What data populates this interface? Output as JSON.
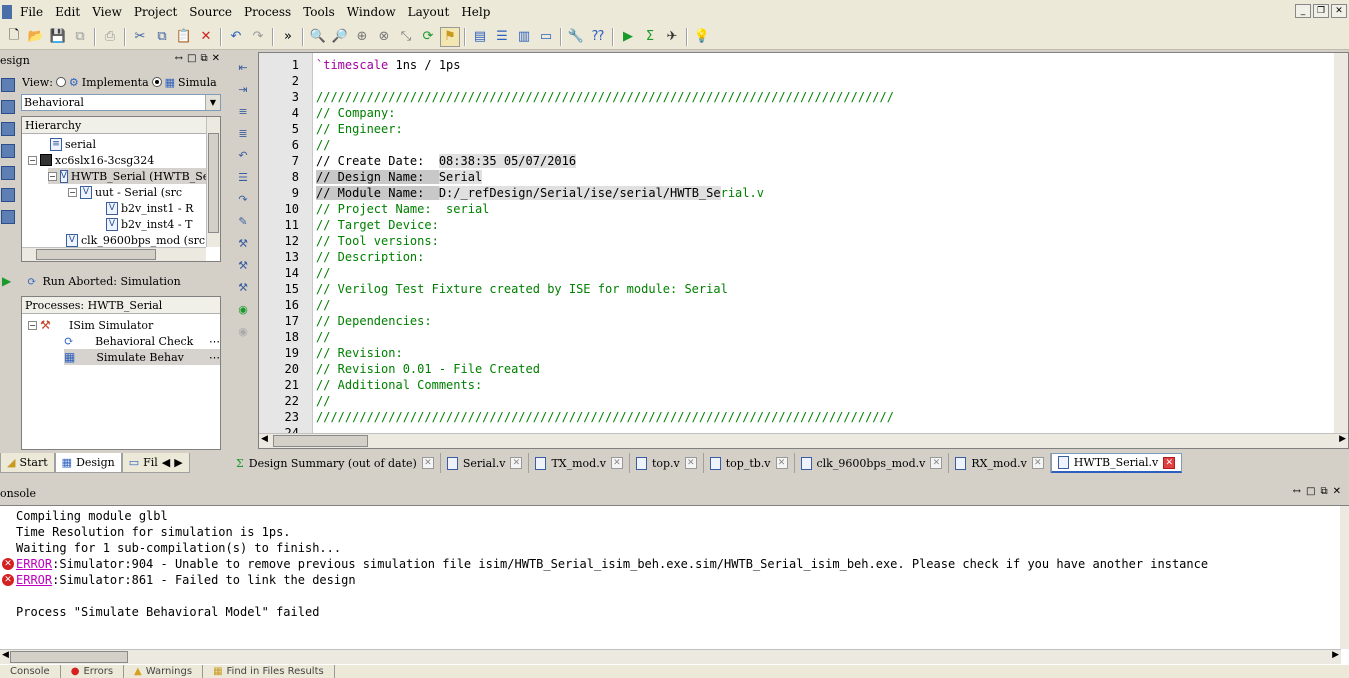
{
  "menu": [
    "File",
    "Edit",
    "View",
    "Project",
    "Source",
    "Process",
    "Tools",
    "Window",
    "Layout",
    "Help"
  ],
  "design_panel": {
    "title": "esign",
    "view_label": "View:",
    "view_implementation": "Implementa",
    "view_simulation": "Simula",
    "dropdown_value": "Behavioral",
    "hierarchy_header": "Hierarchy",
    "tree": [
      {
        "label": "serial",
        "icon": "project-icon"
      },
      {
        "label": "xc6slx16-3csg324",
        "icon": "chip-icon"
      },
      {
        "label": "HWTB_Serial (HWTB_Se",
        "icon": "verilog-icon"
      },
      {
        "label": "uut - Serial (src",
        "icon": "verilog-icon"
      },
      {
        "label": "b2v_inst1 - R",
        "icon": "verilog-icon"
      },
      {
        "label": "b2v_inst4 - T",
        "icon": "verilog-icon"
      },
      {
        "label": "clk_9600bps_mod (src",
        "icon": "verilog-icon"
      }
    ],
    "run_status": "Run Aborted: Simulation",
    "processes_header": "Processes: HWTB_Serial",
    "processes": [
      {
        "label": "ISim Simulator"
      },
      {
        "label": "Behavioral Check"
      },
      {
        "label": "Simulate Behav"
      }
    ]
  },
  "left_tabs": [
    "Start",
    "Design",
    "Fil"
  ],
  "editor": {
    "lines": [
      {
        "n": "1",
        "text": "`timescale 1ns / 1ps"
      },
      {
        "n": "2",
        "text": ""
      },
      {
        "n": "3",
        "text": "////////////////////////////////////////////////////////////////////////////////"
      },
      {
        "n": "4",
        "text": "// Company:"
      },
      {
        "n": "5",
        "text": "// Engineer:"
      },
      {
        "n": "6",
        "text": "//"
      },
      {
        "n": "7",
        "text": "// Create Date:  ",
        "highlight": "08:38:35 05/07/2016"
      },
      {
        "n": "8",
        "text": "// Design Name:  ",
        "highlight": "Serial"
      },
      {
        "n": "9",
        "text": "// Module Name:  ",
        "highlight": "D:/_refDesign/Serial/ise/serial/HWTB_Se",
        "rest": "rial.v"
      },
      {
        "n": "10",
        "text": "// Project Name:  serial"
      },
      {
        "n": "11",
        "text": "// Target Device:"
      },
      {
        "n": "12",
        "text": "// Tool versions:"
      },
      {
        "n": "13",
        "text": "// Description:"
      },
      {
        "n": "14",
        "text": "//"
      },
      {
        "n": "15",
        "text": "// Verilog Test Fixture created by ISE for module: Serial"
      },
      {
        "n": "16",
        "text": "//"
      },
      {
        "n": "17",
        "text": "// Dependencies:"
      },
      {
        "n": "18",
        "text": "//"
      },
      {
        "n": "19",
        "text": "// Revision:"
      },
      {
        "n": "20",
        "text": "// Revision 0.01 - File Created"
      },
      {
        "n": "21",
        "text": "// Additional Comments:"
      },
      {
        "n": "22",
        "text": "//"
      },
      {
        "n": "23",
        "text": "////////////////////////////////////////////////////////////////////////////////"
      },
      {
        "n": "24",
        "text": ""
      }
    ]
  },
  "doc_tabs": [
    {
      "label": "Design Summary (out of date)"
    },
    {
      "label": "Serial.v"
    },
    {
      "label": "TX_mod.v"
    },
    {
      "label": "top.v"
    },
    {
      "label": "top_tb.v"
    },
    {
      "label": "clk_9600bps_mod.v"
    },
    {
      "label": "RX_mod.v"
    },
    {
      "label": "HWTB_Serial.v",
      "active": true
    }
  ],
  "console": {
    "title": "onsole",
    "lines": [
      {
        "text": "Compiling module glbl"
      },
      {
        "text": "Time Resolution for simulation is 1ps."
      },
      {
        "text": "Waiting for 1 sub-compilation(s) to finish..."
      },
      {
        "error": true,
        "link": "ERROR",
        "text": ":Simulator:904 - Unable to remove previous simulation file isim/HWTB_Serial_isim_beh.exe.sim/HWTB_Serial_isim_beh.exe. Please check if you have another instance"
      },
      {
        "error": true,
        "link": "ERROR",
        "text": ":Simulator:861 - Failed to link the design"
      },
      {
        "text": ""
      },
      {
        "text": "Process \"Simulate Behavioral Model\" failed"
      }
    ]
  },
  "bottom_tabs": [
    "Console",
    "Errors",
    "Warnings",
    "Find in Files Results"
  ],
  "colors": {
    "comment": "#008000",
    "keyword": "#a000a0",
    "error": "#d42020",
    "accent": "#2c5fbf"
  }
}
